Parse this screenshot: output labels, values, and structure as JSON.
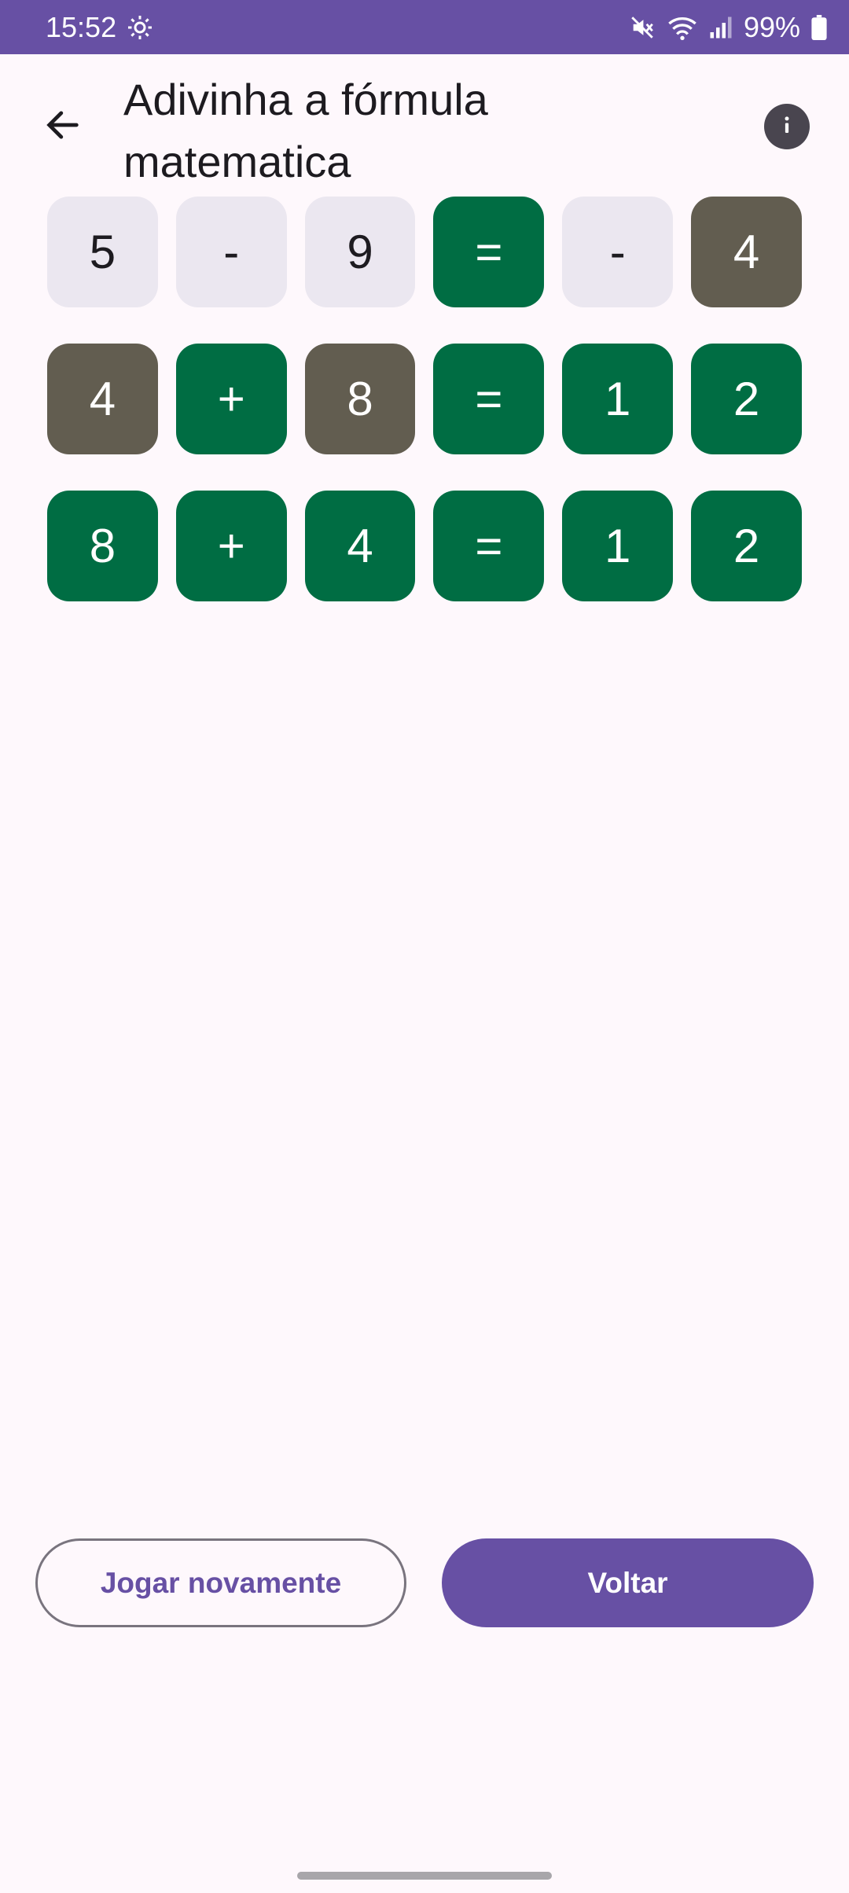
{
  "status_bar": {
    "time": "15:52",
    "battery": "99%",
    "icons": [
      "settings-icon",
      "mute-icon",
      "wifi-icon",
      "signal-icon",
      "battery-icon"
    ]
  },
  "app_bar": {
    "title": "Adivinha a fórmula matematica",
    "back_icon": "arrow-back-icon",
    "info_icon": "info-icon"
  },
  "board": {
    "rows": [
      [
        {
          "value": "5",
          "state": "empty"
        },
        {
          "value": "-",
          "state": "empty"
        },
        {
          "value": "9",
          "state": "empty"
        },
        {
          "value": "=",
          "state": "correct"
        },
        {
          "value": "-",
          "state": "empty"
        },
        {
          "value": "4",
          "state": "present"
        }
      ],
      [
        {
          "value": "4",
          "state": "present"
        },
        {
          "value": "+",
          "state": "correct"
        },
        {
          "value": "8",
          "state": "present"
        },
        {
          "value": "=",
          "state": "correct"
        },
        {
          "value": "1",
          "state": "correct"
        },
        {
          "value": "2",
          "state": "correct"
        }
      ],
      [
        {
          "value": "8",
          "state": "correct"
        },
        {
          "value": "+",
          "state": "correct"
        },
        {
          "value": "4",
          "state": "correct"
        },
        {
          "value": "=",
          "state": "correct"
        },
        {
          "value": "1",
          "state": "correct"
        },
        {
          "value": "2",
          "state": "correct"
        }
      ]
    ]
  },
  "actions": {
    "play_again_label": "Jogar novamente",
    "back_label": "Voltar"
  },
  "colors": {
    "primary": "#6750a4",
    "correct": "#006d43",
    "present": "#625d50",
    "empty": "#ebe7f0",
    "background": "#fef8fc"
  }
}
